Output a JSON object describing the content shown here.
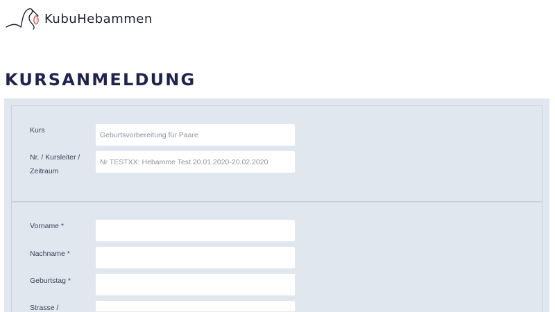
{
  "header": {
    "brand": "KubuHebammen",
    "logo_icon": "stork-icon"
  },
  "page": {
    "title": "KURSANMELDUNG"
  },
  "course": {
    "kurs_label": "Kurs",
    "kurs_value": "Geburtsvorbereitung für Paare",
    "nr_label_line1": "Nr. / Kursleiter /",
    "nr_label_line2": "Zeitraum",
    "nr_value": "Nr TESTXX: Hebamme Test 20.01.2020-20.02.2020"
  },
  "person": {
    "vorname_label": "Vorname *",
    "vorname_value": "",
    "nachname_label": "Nachname *",
    "nachname_value": "",
    "geburtstag_label": "Geburtstag *",
    "geburtstag_value": "",
    "strasse_label": "Strasse /",
    "strasse_value": ""
  },
  "colors": {
    "title": "#1f2350",
    "form_background": "#e1e7ee",
    "field_background": "#ffffff",
    "logo_accent": "#e0403a"
  }
}
